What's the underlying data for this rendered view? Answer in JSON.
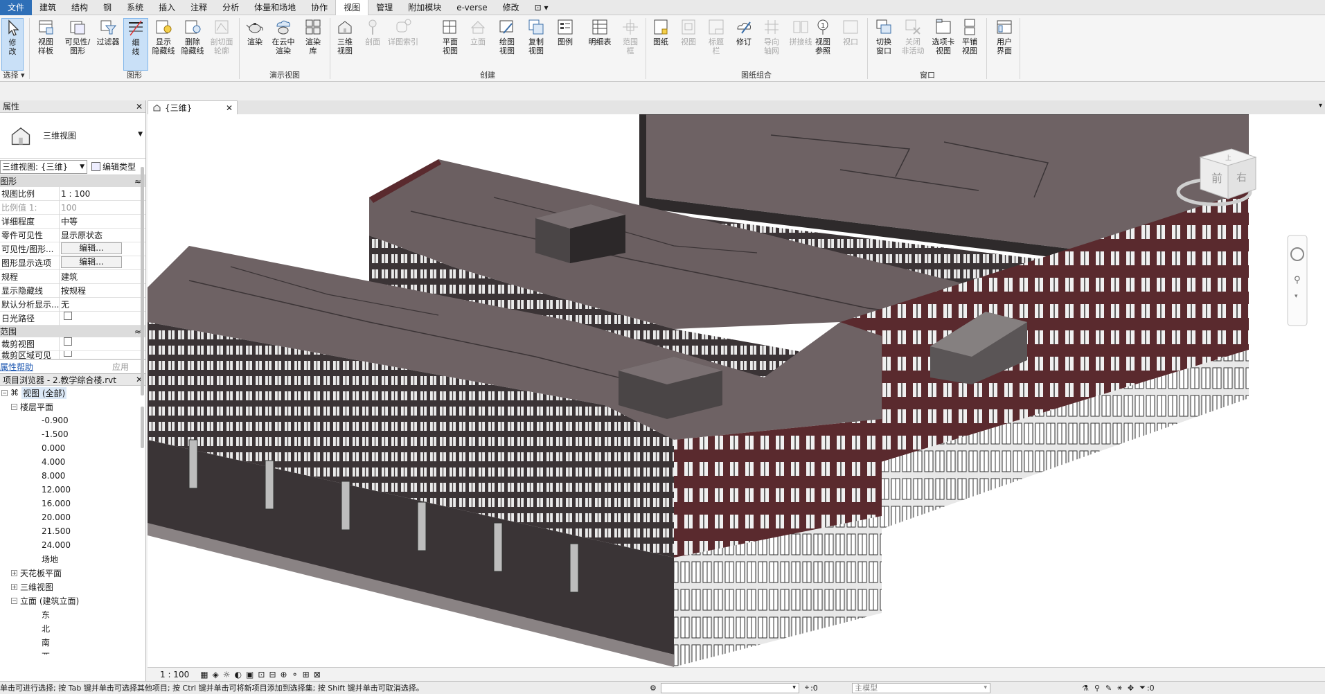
{
  "menu": {
    "file": "文件",
    "tabs": [
      "建筑",
      "结构",
      "钢",
      "系统",
      "插入",
      "注释",
      "分析",
      "体量和场地",
      "协作",
      "视图",
      "管理",
      "附加模块",
      "e-verse",
      "修改"
    ],
    "extra": "⊡ ▾"
  },
  "ribbon": {
    "select": {
      "modify_l1": "修",
      "modify_l2": "改",
      "select_label": "选择 ▾"
    },
    "graphics": {
      "b1a": "视图",
      "b1b": "样板",
      "b2a": "可见性/",
      "b2b": "图形",
      "b3a": "过滤器",
      "b4a": "细",
      "b4b": "线",
      "b5a": "显示",
      "b5b": "隐藏线",
      "b6a": "删除",
      "b6b": "隐藏线",
      "b7a": "剖切面",
      "b7b": "轮廓",
      "label": "图形"
    },
    "presentation": {
      "b1": "渲染",
      "b2a": "在云中",
      "b2b": "渲染",
      "b3a": "渲染",
      "b3b": "库",
      "label": "演示视图"
    },
    "create": {
      "b1a": "三维",
      "b1b": "视图",
      "b2": "剖面",
      "b3": "详图索引",
      "b4a": "平面",
      "b4b": "视图",
      "b5": "立面",
      "b6a": "绘图",
      "b6b": "视图",
      "b7a": "复制",
      "b7b": "视图",
      "b8": "图例",
      "b9": "明细表",
      "b10a": "范围",
      "b10b": "框",
      "label": "创建"
    },
    "sheet": {
      "b1": "图纸",
      "b2": "视图",
      "b3a": "标题",
      "b3b": "栏",
      "b4": "修订",
      "b5a": "导向",
      "b5b": "轴网",
      "b6": "拼接线",
      "b7a": "视图",
      "b7b": "参照",
      "b8": "视口",
      "label": "图纸组合"
    },
    "windows": {
      "b1a": "切换",
      "b1b": "窗口",
      "b2a": "关闭",
      "b2b": "非活动",
      "b3a": "选项卡",
      "b3b": "视图",
      "b4a": "平铺",
      "b4b": "视图",
      "label": "窗口"
    },
    "ui": {
      "b1a": "用户",
      "b1b": "界面"
    }
  },
  "properties": {
    "title": "属性",
    "type_name": "三维视图",
    "selector": "三维视图: {三维}",
    "edit_type": "编辑类型",
    "section_graphics": "图形",
    "section_extents": "范围",
    "rows": [
      {
        "k": "视图比例",
        "v": "1 : 100"
      },
      {
        "k": "比例值 1:",
        "v": "100"
      },
      {
        "k": "详细程度",
        "v": "中等"
      },
      {
        "k": "零件可见性",
        "v": "显示原状态"
      },
      {
        "k": "可见性/图形...",
        "v": "编辑..."
      },
      {
        "k": "图形显示选项",
        "v": "编辑..."
      },
      {
        "k": "规程",
        "v": "建筑"
      },
      {
        "k": "显示隐藏线",
        "v": "按规程"
      },
      {
        "k": "默认分析显示...",
        "v": "无"
      },
      {
        "k": "日光路径",
        "v": ""
      }
    ],
    "extent_rows": [
      {
        "k": "裁剪视图"
      },
      {
        "k": "裁剪区域可见"
      }
    ],
    "help": "属性帮助",
    "apply": "应用"
  },
  "browser": {
    "title": "项目浏览器 - 2.教学综合楼.rvt",
    "root": "视图 (全部)",
    "floor_plans": "楼层平面",
    "levels": [
      "-0.900",
      "-1.500",
      "0.000",
      "4.000",
      "8.000",
      "12.000",
      "16.000",
      "20.000",
      "21.500",
      "24.000",
      "场地"
    ],
    "ceiling": "天花板平面",
    "threed": "三维视图",
    "elevations": "立面 (建筑立面)",
    "elev_items": [
      "东",
      "北",
      "南",
      "西"
    ]
  },
  "viewtab": {
    "label": "{三维}"
  },
  "viewcube": {
    "front": "前",
    "right": "右",
    "top": "上"
  },
  "viewbar": {
    "scale": "1 : 100"
  },
  "status": {
    "message": "单击可进行选择; 按 Tab 键并单击可选择其他项目; 按 Ctrl 键并单击可将新项目添加到选择集; 按 Shift 键并单击可取消选择。",
    "count": ":0",
    "model": "主模型",
    "filter": ":0"
  },
  "colors": {
    "accent": "#2e6fb7",
    "roof": "#6e6264",
    "brick": "#5a2a2e",
    "wall": "#3a3436",
    "base": "#e6e6e6"
  }
}
